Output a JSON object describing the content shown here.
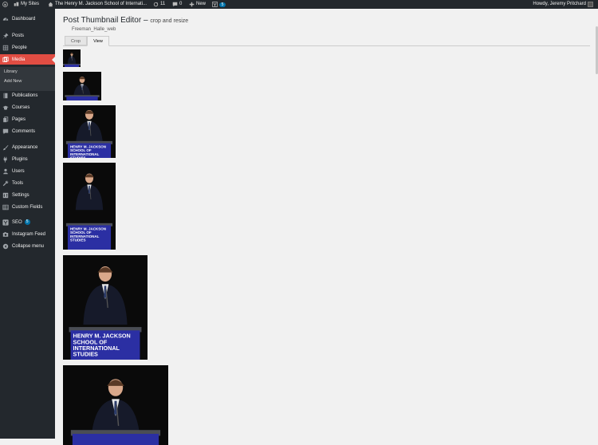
{
  "adminbar": {
    "my_sites": "My Sites",
    "site_name": "The Henry M. Jackson School of Internati...",
    "updates_count": "11",
    "comments_count": "0",
    "new_label": "New",
    "yoast_count": "5",
    "greeting": "Howdy, Jeremy Pritchard"
  },
  "sidebar": {
    "dashboard": "Dashboard",
    "posts": "Posts",
    "people": "People",
    "media": "Media",
    "library": "Library",
    "add_new": "Add New",
    "publications": "Publications",
    "courses": "Courses",
    "pages": "Pages",
    "comments": "Comments",
    "appearance": "Appearance",
    "plugins": "Plugins",
    "users": "Users",
    "tools": "Tools",
    "settings": "Settings",
    "custom_fields": "Custom Fields",
    "seo": "SEO",
    "seo_badge": "5",
    "instagram": "Instagram Feed",
    "collapse": "Collapse menu"
  },
  "editor": {
    "title": "Post Thumbnail Editor",
    "title_dash": " – ",
    "subtitle": "crop and resize",
    "filename": "Freeman_Halle_web",
    "tabs": [
      "Crop",
      "View"
    ],
    "active_tab": "View"
  },
  "podium_text": [
    "HENRY M. JACKSON",
    "SCHOOL OF",
    "INTERNATIONAL",
    "STUDIES"
  ],
  "icons": {
    "wp_logo": "wordpress-icon",
    "home": "home-icon",
    "updates": "refresh-icon",
    "comments": "comment-icon",
    "new": "plus-icon",
    "yoast": "yoast-icon"
  },
  "colors": {
    "admin_dark": "#23282d",
    "menu_current": "#e14d43",
    "submenu": "#32373c",
    "podium_blue": "#2b2fa3",
    "accent": "#0073aa"
  }
}
